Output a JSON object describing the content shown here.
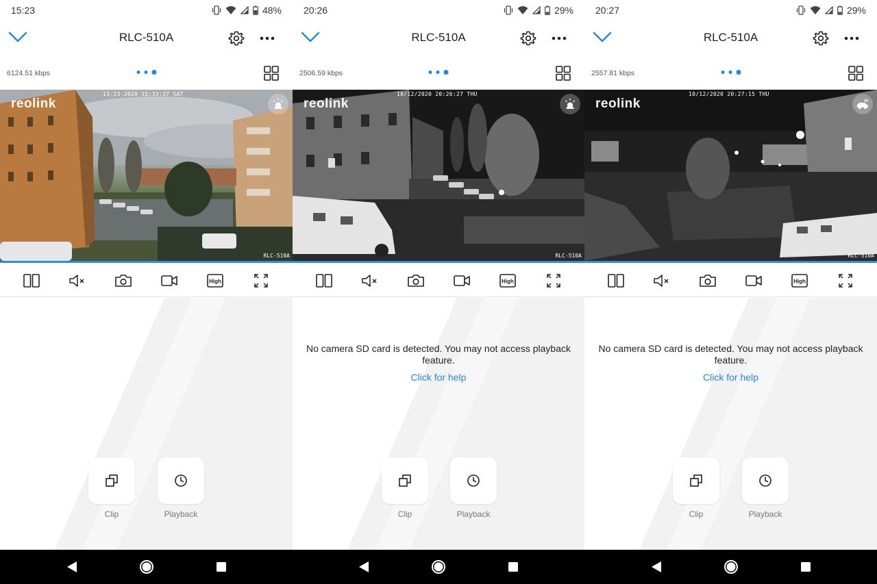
{
  "panels": [
    {
      "status": {
        "time": "15:23",
        "battery": "48%"
      },
      "header": {
        "title": "RLC-510A"
      },
      "bitrate": "6124.51 kbps",
      "video": {
        "logo": "reolink",
        "timestamp": "13-13-2020 15:33:37 SAT",
        "camera_label": "RLC-510A",
        "scene": "day",
        "badge_icon": "siren-icon"
      },
      "message": "",
      "help_link": "",
      "actions": {
        "clip": "Clip",
        "playback": "Playback"
      }
    },
    {
      "status": {
        "time": "20:26",
        "battery": "29%"
      },
      "header": {
        "title": "RLC-510A"
      },
      "bitrate": "2506.59 kbps",
      "video": {
        "logo": "reolink",
        "timestamp": "10/12/2020 20:26:27 THU",
        "camera_label": "RLC-510A",
        "scene": "night",
        "badge_icon": "siren-icon"
      },
      "message": "No camera SD card is detected. You may not access playback feature.",
      "help_link": "Click for help",
      "actions": {
        "clip": "Clip",
        "playback": "Playback"
      }
    },
    {
      "status": {
        "time": "20:27",
        "battery": "29%"
      },
      "header": {
        "title": "RLC-510A"
      },
      "bitrate": "2557.81 kbps",
      "video": {
        "logo": "reolink",
        "timestamp": "10/12/2020 20:27:15 THU",
        "camera_label": "RLC-510A",
        "scene": "night",
        "badge_icon": "ai-vehicle-icon",
        "badge_text": "AI"
      },
      "message": "No camera SD card is detected. You may not access playback feature.",
      "help_link": "Click for help",
      "actions": {
        "clip": "Clip",
        "playback": "Playback"
      }
    }
  ],
  "toolbar_quality_label": "High",
  "colors": {
    "accent": "#1e88e5",
    "link": "#1f8ad8",
    "progress": "#2f8ee0",
    "lower_bg": "#f2f2f2",
    "navbar": "#000000"
  }
}
